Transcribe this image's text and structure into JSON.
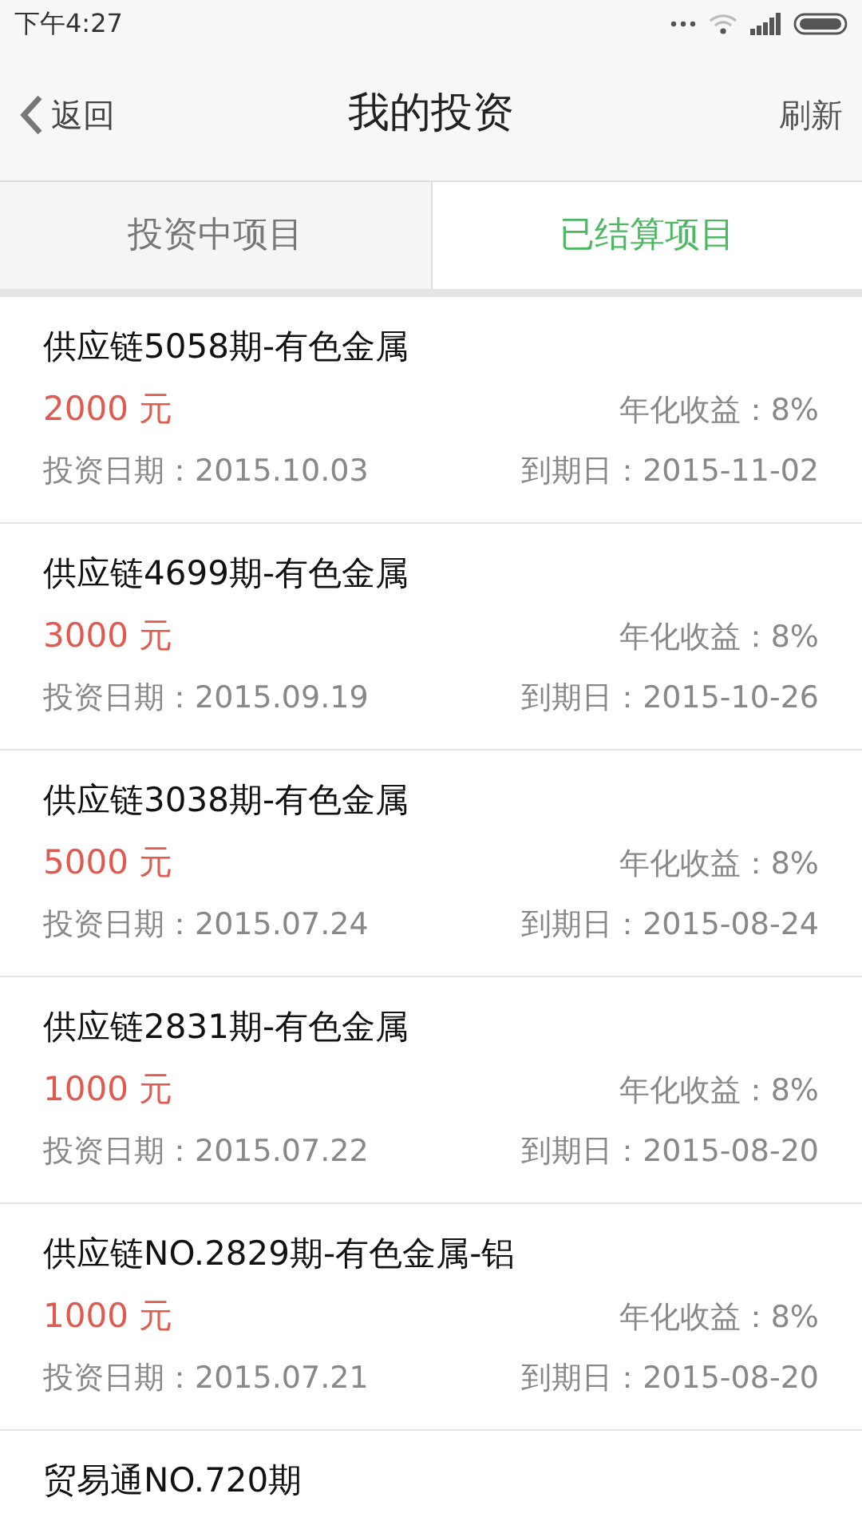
{
  "status_bar": {
    "time": "下午4:27"
  },
  "header": {
    "back": "返回",
    "title": "我的投资",
    "action": "刷新"
  },
  "tabs": [
    {
      "label": "投资中项目",
      "selected": false
    },
    {
      "label": "已结算项目",
      "selected": true
    }
  ],
  "items": [
    {
      "title": "供应链5058期-有色金属",
      "amount": "2000 元",
      "rate": "年化收益：8%",
      "invest_date": "投资日期：2015.10.03",
      "due_date": "到期日：2015-11-02"
    },
    {
      "title": "供应链4699期-有色金属",
      "amount": "3000 元",
      "rate": "年化收益：8%",
      "invest_date": "投资日期：2015.09.19",
      "due_date": "到期日：2015-10-26"
    },
    {
      "title": "供应链3038期-有色金属",
      "amount": "5000 元",
      "rate": "年化收益：8%",
      "invest_date": "投资日期：2015.07.24",
      "due_date": "到期日：2015-08-24"
    },
    {
      "title": "供应链2831期-有色金属",
      "amount": "1000 元",
      "rate": "年化收益：8%",
      "invest_date": "投资日期：2015.07.22",
      "due_date": "到期日：2015-08-20"
    },
    {
      "title": "供应链NO.2829期-有色金属-铝",
      "amount": "1000 元",
      "rate": "年化收益：8%",
      "invest_date": "投资日期：2015.07.21",
      "due_date": "到期日：2015-08-20"
    },
    {
      "title": "贸易通NO.720期"
    }
  ]
}
